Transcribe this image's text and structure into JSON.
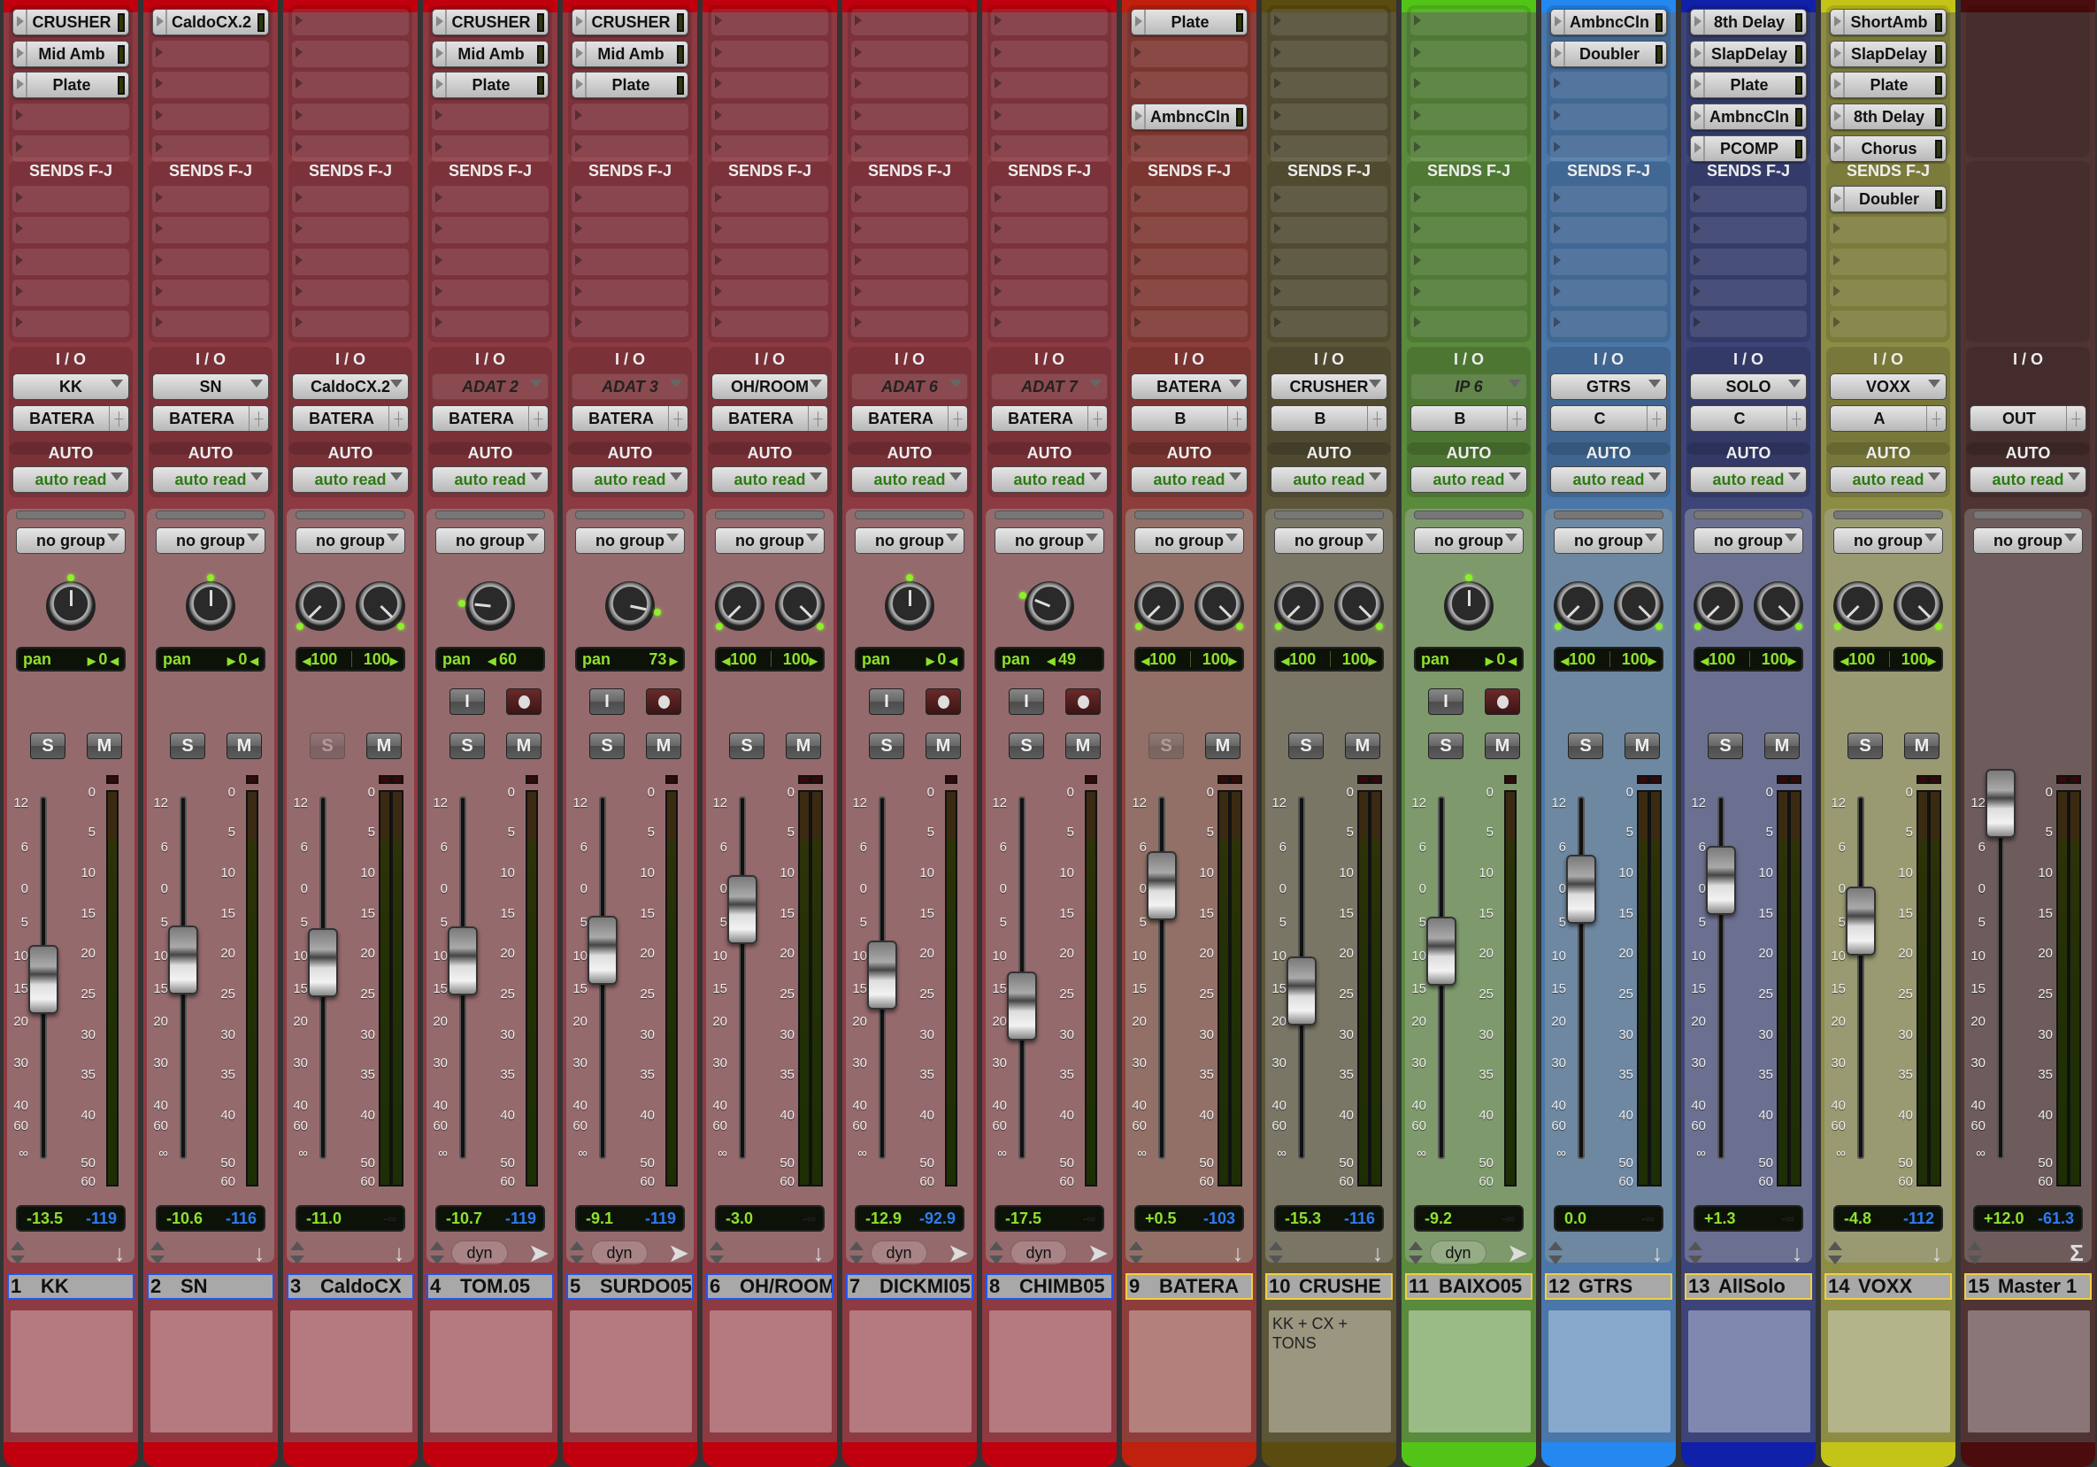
{
  "app": {
    "window": "Mix"
  },
  "labels": {
    "sends": "SENDS F-J",
    "io": "I / O",
    "auto": "AUTO",
    "pan": "pan",
    "solo": "S",
    "mute": "M",
    "input": "I",
    "dyn": "dyn"
  },
  "strips": [
    {
      "num": "1",
      "name": "KK",
      "color": "#c0000e",
      "body": "#8e3a42",
      "lower": "#956a6d",
      "comment_bg": "#b47a7f",
      "name_border": "blue",
      "inserts": [
        "CRUSHER",
        "Mid Amb",
        "Plate",
        "",
        ""
      ],
      "sends": [
        "",
        "",
        "",
        "",
        ""
      ],
      "input": "KK",
      "input_active": true,
      "output": "BATERA",
      "auto": "auto read",
      "group": "no group",
      "pan_type": "mono",
      "pan_left": "pan",
      "pan_val": "0",
      "pan_dir": "center",
      "knobs": [
        0
      ],
      "has_input_rec": false,
      "solo_dim": false,
      "vol": "-13.5",
      "peak": "-119",
      "peak_inf": false,
      "fader_db": -13.5,
      "meter_count": 1,
      "bottom_icon": "down-arrow",
      "show_dyn": false,
      "comment": ""
    },
    {
      "num": "2",
      "name": "SN",
      "color": "#c0000e",
      "body": "#8e3a42",
      "lower": "#956a6d",
      "comment_bg": "#b47a7f",
      "name_border": "blue",
      "inserts": [
        "CaldoCX.2",
        "",
        "",
        "",
        ""
      ],
      "sends": [
        "",
        "",
        "",
        "",
        ""
      ],
      "input": "SN",
      "input_active": true,
      "output": "BATERA",
      "auto": "auto read",
      "group": "no group",
      "pan_type": "mono",
      "pan_left": "pan",
      "pan_val": "0",
      "pan_dir": "center",
      "knobs": [
        0
      ],
      "has_input_rec": false,
      "solo_dim": false,
      "vol": "-10.6",
      "peak": "-116",
      "peak_inf": false,
      "fader_db": -10.6,
      "meter_count": 1,
      "bottom_icon": "down-arrow",
      "show_dyn": false,
      "comment": ""
    },
    {
      "num": "3",
      "name": "CaldoCX",
      "color": "#c0000e",
      "body": "#8e3a42",
      "lower": "#956a6d",
      "comment_bg": "#b47a7f",
      "name_border": "blue",
      "inserts": [
        "",
        "",
        "",
        "",
        ""
      ],
      "sends": [
        "",
        "",
        "",
        "",
        ""
      ],
      "input": "CaldoCX.2",
      "input_active": true,
      "output": "BATERA",
      "auto": "auto read",
      "group": "no group",
      "pan_type": "stereo",
      "pan_l": "100",
      "pan_r": "100",
      "knobs": [
        -135,
        135
      ],
      "has_input_rec": false,
      "solo_dim": true,
      "vol": "-11.0",
      "peak": "-∞",
      "peak_inf": true,
      "fader_db": -11.0,
      "meter_count": 2,
      "bottom_icon": "down-arrow",
      "show_dyn": false,
      "comment": ""
    },
    {
      "num": "4",
      "name": "TOM.05",
      "color": "#c0000e",
      "body": "#8e3a42",
      "lower": "#956a6d",
      "comment_bg": "#b47a7f",
      "name_border": "blue",
      "inserts": [
        "CRUSHER",
        "Mid Amb",
        "Plate",
        "",
        ""
      ],
      "sends": [
        "",
        "",
        "",
        "",
        ""
      ],
      "input": "ADAT 2",
      "input_active": false,
      "output": "BATERA",
      "auto": "auto read",
      "group": "no group",
      "pan_type": "mono",
      "pan_left": "pan",
      "pan_val": "60",
      "pan_dir": "left",
      "knobs": [
        -84
      ],
      "has_input_rec": true,
      "solo_dim": false,
      "vol": "-10.7",
      "peak": "-119",
      "peak_inf": false,
      "fader_db": -10.7,
      "meter_count": 1,
      "bottom_icon": "arrow-right",
      "show_dyn": true,
      "comment": ""
    },
    {
      "num": "5",
      "name": "SURDO05",
      "color": "#c0000e",
      "body": "#8e3a42",
      "lower": "#956a6d",
      "comment_bg": "#b47a7f",
      "name_border": "blue",
      "inserts": [
        "CRUSHER",
        "Mid Amb",
        "Plate",
        "",
        ""
      ],
      "sends": [
        "",
        "",
        "",
        "",
        ""
      ],
      "input": "ADAT 3",
      "input_active": false,
      "output": "BATERA",
      "auto": "auto read",
      "group": "no group",
      "pan_type": "mono",
      "pan_left": "pan",
      "pan_val": "73",
      "pan_dir": "right",
      "knobs": [
        102
      ],
      "has_input_rec": true,
      "solo_dim": false,
      "vol": "-9.1",
      "peak": "-119",
      "peak_inf": false,
      "fader_db": -9.1,
      "meter_count": 1,
      "bottom_icon": "arrow-right",
      "show_dyn": true,
      "comment": ""
    },
    {
      "num": "6",
      "name": "OH/ROOM",
      "color": "#c0000e",
      "body": "#8e3a42",
      "lower": "#956a6d",
      "comment_bg": "#b47a7f",
      "name_border": "blue",
      "inserts": [
        "",
        "",
        "",
        "",
        ""
      ],
      "sends": [
        "",
        "",
        "",
        "",
        ""
      ],
      "input": "OH/ROOM",
      "input_active": true,
      "output": "BATERA",
      "auto": "auto read",
      "group": "no group",
      "pan_type": "stereo",
      "pan_l": "100",
      "pan_r": "100",
      "knobs": [
        -135,
        135
      ],
      "has_input_rec": false,
      "solo_dim": false,
      "vol": "-3.0",
      "peak": "-∞",
      "peak_inf": true,
      "fader_db": -3.0,
      "meter_count": 2,
      "bottom_icon": "down-arrow",
      "show_dyn": false,
      "comment": ""
    },
    {
      "num": "7",
      "name": "DICKMI05",
      "color": "#c0000e",
      "body": "#8e3a42",
      "lower": "#956a6d",
      "comment_bg": "#b47a7f",
      "name_border": "blue",
      "inserts": [
        "",
        "",
        "",
        "",
        ""
      ],
      "sends": [
        "",
        "",
        "",
        "",
        ""
      ],
      "input": "ADAT 6",
      "input_active": false,
      "output": "BATERA",
      "auto": "auto read",
      "group": "no group",
      "pan_type": "mono",
      "pan_left": "pan",
      "pan_val": "0",
      "pan_dir": "center",
      "knobs": [
        0
      ],
      "has_input_rec": true,
      "solo_dim": false,
      "vol": "-12.9",
      "peak": "-92.9",
      "peak_inf": false,
      "fader_db": -12.9,
      "meter_count": 1,
      "bottom_icon": "arrow-right",
      "show_dyn": true,
      "comment": ""
    },
    {
      "num": "8",
      "name": "CHIMB05",
      "color": "#c0000e",
      "body": "#8e3a42",
      "lower": "#956a6d",
      "comment_bg": "#b47a7f",
      "name_border": "blue",
      "inserts": [
        "",
        "",
        "",
        "",
        ""
      ],
      "sends": [
        "",
        "",
        "",
        "",
        ""
      ],
      "input": "ADAT 7",
      "input_active": false,
      "output": "BATERA",
      "auto": "auto read",
      "group": "no group",
      "pan_type": "mono",
      "pan_left": "pan",
      "pan_val": "49",
      "pan_dir": "left",
      "knobs": [
        -68
      ],
      "has_input_rec": true,
      "solo_dim": false,
      "vol": "-17.5",
      "peak": "-∞",
      "peak_inf": true,
      "fader_db": -17.5,
      "meter_count": 1,
      "bottom_icon": "arrow-right",
      "show_dyn": true,
      "comment": ""
    },
    {
      "num": "9",
      "name": "BATERA",
      "color": "#c0200e",
      "body": "#8e3e3a",
      "lower": "#927068",
      "comment_bg": "#b4807b",
      "name_border": "yellow",
      "inserts": [
        "Plate",
        "",
        "",
        "AmbncCln",
        ""
      ],
      "sends": [
        "",
        "",
        "",
        "",
        ""
      ],
      "input": "BATERA",
      "input_active": true,
      "output": "B",
      "auto": "auto read",
      "group": "no group",
      "pan_type": "stereo",
      "pan_l": "100",
      "pan_r": "100",
      "knobs": [
        -135,
        135
      ],
      "has_input_rec": false,
      "solo_dim": true,
      "vol": "+0.5",
      "peak": "-103",
      "peak_inf": false,
      "fader_db": 0.5,
      "meter_count": 2,
      "bottom_icon": "down-arrow",
      "show_dyn": false,
      "comment": ""
    },
    {
      "num": "10",
      "name": "CRUSHE",
      "color": "#5a4c10",
      "body": "#5c5538",
      "lower": "#7a7666",
      "comment_bg": "#9a9680",
      "name_border": "yellow",
      "inserts": [
        "",
        "",
        "",
        "",
        ""
      ],
      "sends": [
        "",
        "",
        "",
        "",
        ""
      ],
      "input": "CRUSHER",
      "input_active": true,
      "output": "B",
      "auto": "auto read",
      "group": "no group",
      "pan_type": "stereo",
      "pan_l": "100",
      "pan_r": "100",
      "knobs": [
        -135,
        135
      ],
      "has_input_rec": false,
      "solo_dim": false,
      "vol": "-15.3",
      "peak": "-116",
      "peak_inf": false,
      "fader_db": -15.3,
      "meter_count": 2,
      "bottom_icon": "down-arrow",
      "show_dyn": false,
      "comment": "KK + CX + TONS"
    },
    {
      "num": "11",
      "name": "BAIXO05",
      "color": "#52c418",
      "body": "#5a8a3c",
      "lower": "#7e9a6c",
      "comment_bg": "#9aba86",
      "name_border": "yellow",
      "inserts": [
        "",
        "",
        "",
        "",
        ""
      ],
      "sends": [
        "",
        "",
        "",
        "",
        ""
      ],
      "input": "IP 6",
      "input_active": false,
      "output": "B",
      "auto": "auto read",
      "group": "no group",
      "pan_type": "mono",
      "pan_left": "pan",
      "pan_val": "0",
      "pan_dir": "center",
      "knobs": [
        0
      ],
      "has_input_rec": true,
      "solo_dim": false,
      "vol": "-9.2",
      "peak": "-∞",
      "peak_inf": true,
      "fader_db": -9.2,
      "meter_count": 1,
      "bottom_icon": "arrow-right",
      "show_dyn": true,
      "comment": ""
    },
    {
      "num": "12",
      "name": "GTRS",
      "color": "#2488f0",
      "body": "#4a76a8",
      "lower": "#6e88a2",
      "comment_bg": "#88a8cc",
      "name_border": "yellow",
      "inserts": [
        "AmbncCln",
        "Doubler",
        "",
        "",
        ""
      ],
      "sends": [
        "",
        "",
        "",
        "",
        ""
      ],
      "input": "GTRS",
      "input_active": true,
      "output": "C",
      "auto": "auto read",
      "group": "no group",
      "pan_type": "stereo",
      "pan_l": "100",
      "pan_r": "100",
      "knobs": [
        -135,
        135
      ],
      "has_input_rec": false,
      "solo_dim": false,
      "vol": "0.0",
      "peak": "-∞",
      "peak_inf": true,
      "fader_db": 0.0,
      "meter_count": 2,
      "bottom_icon": "down-arrow",
      "show_dyn": false,
      "comment": ""
    },
    {
      "num": "13",
      "name": "AllSolo",
      "color": "#1020a8",
      "body": "#3c4478",
      "lower": "#6c7090",
      "comment_bg": "#8088b0",
      "name_border": "yellow",
      "inserts": [
        "8th Delay",
        "SlapDelay",
        "Plate",
        "AmbncCln",
        "PCOMP"
      ],
      "sends": [
        "",
        "",
        "",
        "",
        ""
      ],
      "input": "SOLO",
      "input_active": true,
      "output": "C",
      "auto": "auto read",
      "group": "no group",
      "pan_type": "stereo",
      "pan_l": "100",
      "pan_r": "100",
      "knobs": [
        -135,
        135
      ],
      "has_input_rec": false,
      "solo_dim": false,
      "vol": "+1.3",
      "peak": "-∞",
      "peak_inf": true,
      "fader_db": 1.3,
      "meter_count": 2,
      "bottom_icon": "down-arrow",
      "show_dyn": false,
      "comment": ""
    },
    {
      "num": "14",
      "name": "VOXX",
      "color": "#c4c418",
      "body": "#8c8c44",
      "lower": "#9a9a72",
      "comment_bg": "#b4b48a",
      "name_border": "yellow",
      "inserts": [
        "ShortAmb",
        "SlapDelay",
        "Plate",
        "8th Delay",
        "Chorus"
      ],
      "sends": [
        "Doubler",
        "",
        "",
        "",
        ""
      ],
      "input": "VOXX",
      "input_active": true,
      "output": "A",
      "auto": "auto read",
      "group": "no group",
      "pan_type": "stereo",
      "pan_l": "100",
      "pan_r": "100",
      "knobs": [
        -135,
        135
      ],
      "has_input_rec": false,
      "solo_dim": false,
      "vol": "-4.8",
      "peak": "-112",
      "peak_inf": false,
      "fader_db": -4.8,
      "meter_count": 2,
      "bottom_icon": "down-arrow",
      "show_dyn": false,
      "comment": ""
    },
    {
      "num": "15",
      "name": "Master 1",
      "color": "#4a0c0c",
      "body": "#503434",
      "lower": "#6e5c5c",
      "comment_bg": "#8a7676",
      "name_border": "yellow",
      "master": true,
      "inserts": [],
      "sends": [],
      "input": "",
      "input_active": true,
      "output": "OUT",
      "auto": "auto read",
      "group": "no group",
      "pan_type": "none",
      "knobs": [],
      "has_input_rec": false,
      "solo_dim": false,
      "no_sm": true,
      "vol": "+12.0",
      "peak": "-61.3",
      "peak_inf": false,
      "fader_db": 12.0,
      "meter_count": 2,
      "bottom_icon": "sigma",
      "show_dyn": false,
      "comment": ""
    }
  ],
  "fader_scale": [
    "12",
    "6",
    "0",
    "5",
    "10",
    "15",
    "20",
    "30",
    "40",
    "60",
    "∞"
  ],
  "meter_scale": [
    "0",
    "5",
    "10",
    "15",
    "20",
    "25",
    "30",
    "35",
    "40",
    "50",
    "60"
  ]
}
